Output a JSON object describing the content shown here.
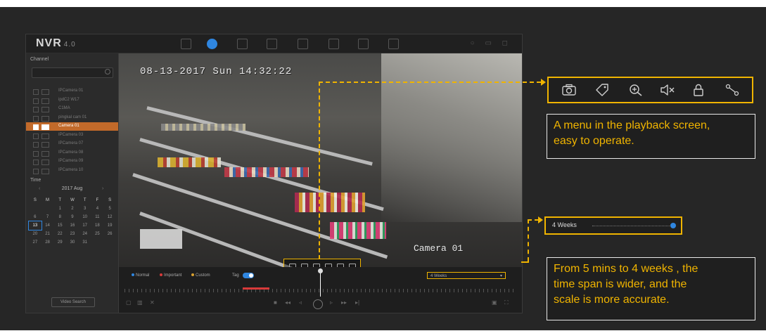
{
  "app": {
    "name": "NVR",
    "version": "4.0"
  },
  "sidebar": {
    "channel_title": "Channel",
    "channels": [
      "IPCamera 01",
      "ipdC2 W17",
      "C1MA",
      "pingkal cam 01",
      "Camera 01",
      "IPCamera 03",
      "IPCamera 07",
      "IPCamera 08",
      "IPCamera 09",
      "IPCamera 10"
    ],
    "selected_channel": "Camera 01",
    "time_title": "Time",
    "calendar_month": "2017 Aug",
    "weekdays": [
      "S",
      "M",
      "T",
      "W",
      "T",
      "F",
      "S"
    ],
    "weeks": [
      [
        "",
        "",
        "1",
        "2",
        "3",
        "4",
        "5"
      ],
      [
        "6",
        "7",
        "8",
        "9",
        "10",
        "11",
        "12"
      ],
      [
        "13",
        "14",
        "15",
        "16",
        "17",
        "18",
        "19"
      ],
      [
        "20",
        "21",
        "22",
        "23",
        "24",
        "25",
        "26"
      ],
      [
        "27",
        "28",
        "29",
        "30",
        "31",
        "",
        ""
      ]
    ],
    "today": "13",
    "video_search_label": "Video Search"
  },
  "video": {
    "timestamp": "08-13-2017 Sun 14:32:22",
    "camera_label": "Camera 01"
  },
  "timeline": {
    "legend": [
      "Normal",
      "Important",
      "Custom"
    ],
    "legend_colors": [
      "#2f86e0",
      "#d83a3a",
      "#d8a030"
    ],
    "tag_label": "Tag",
    "span_value": "4 Weeks"
  },
  "callouts": {
    "menu_note_line1": "A menu in the playback screen,",
    "menu_note_line2": "easy to operate.",
    "span_note_line1": "From 5 mins to 4 weeks , the",
    "span_note_line2": "time span is wider, and the",
    "span_note_line3": "scale is more accurate.",
    "weeks_label": "4 Weeks",
    "toolbar_icons": [
      "camera-icon",
      "tag-icon",
      "zoom-in-icon",
      "speaker-mute-icon",
      "lock-icon",
      "scissors-icon"
    ]
  },
  "colors": {
    "accent": "#f0b400",
    "selection": "#c26a2a",
    "active": "#2f86e0"
  }
}
